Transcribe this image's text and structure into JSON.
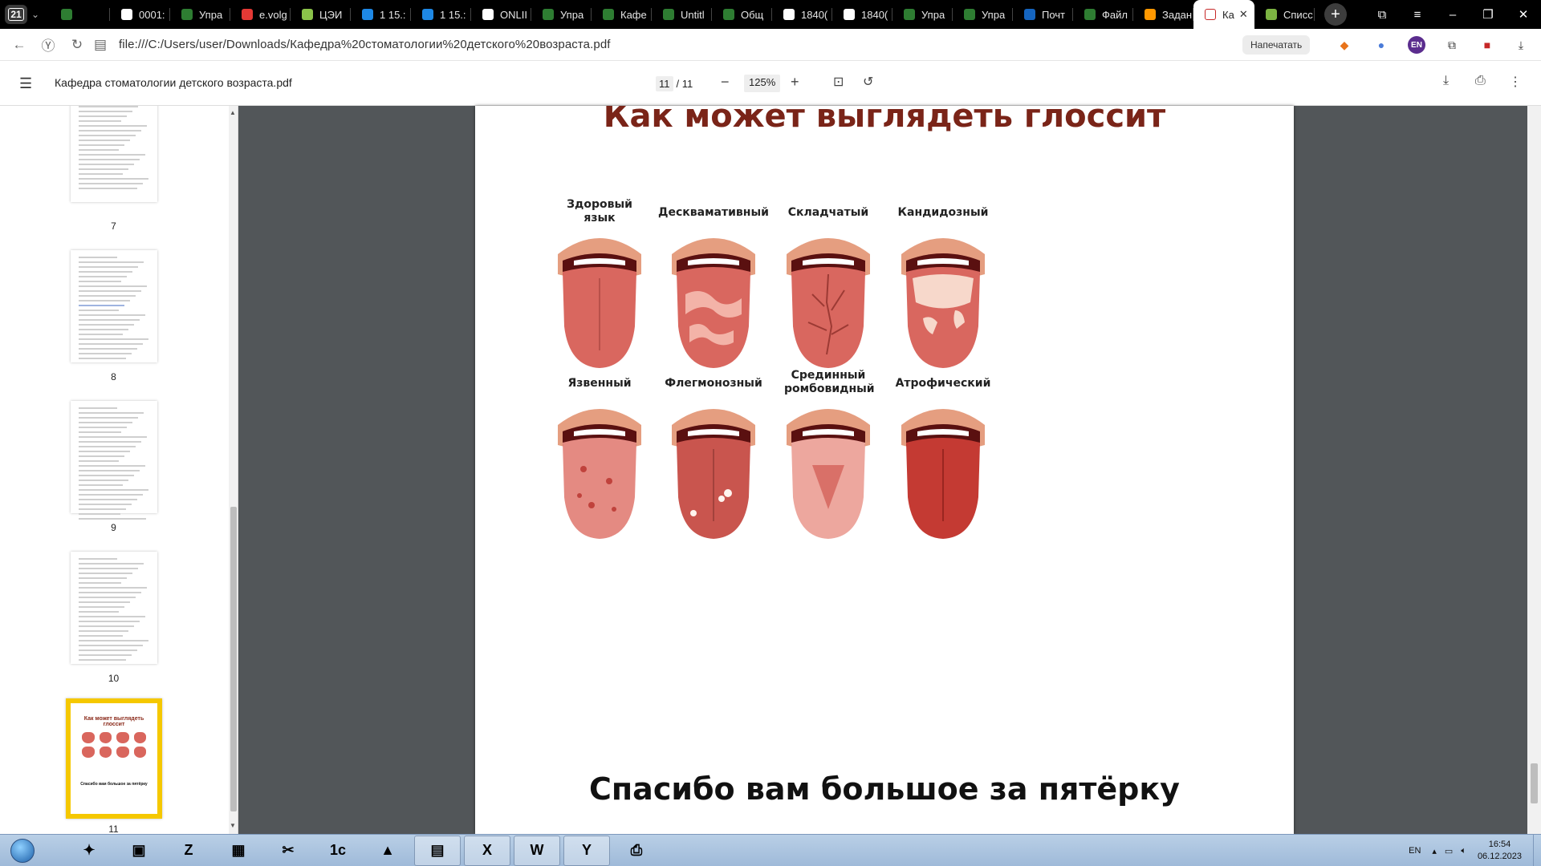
{
  "tab_strip": {
    "tab_count": "21",
    "tabs": [
      {
        "label": "",
        "icon": "green-circle-icon",
        "color": "#2e7d32"
      },
      {
        "label": "0001:",
        "icon": "pdf-icon",
        "color": "#ffffff"
      },
      {
        "label": "Упра",
        "icon": "green-circle-icon",
        "color": "#2e7d32"
      },
      {
        "label": "e.volg",
        "icon": "yandex-icon",
        "color": "#e53935"
      },
      {
        "label": "ЦЭИ",
        "icon": "grid-icon",
        "color": "#8bc34a"
      },
      {
        "label": "1 15.:",
        "icon": "docs-icon",
        "color": "#1e88e5"
      },
      {
        "label": "1 15.:",
        "icon": "docs-icon",
        "color": "#1e88e5"
      },
      {
        "label": "ONLII",
        "icon": "pdf-icon",
        "color": "#ffffff"
      },
      {
        "label": "Упра",
        "icon": "green-circle-icon",
        "color": "#2e7d32"
      },
      {
        "label": "Кафе",
        "icon": "green-circle-icon",
        "color": "#2e7d32"
      },
      {
        "label": "Untitl",
        "icon": "green-circle-icon",
        "color": "#2e7d32"
      },
      {
        "label": "Общ",
        "icon": "green-circle-icon",
        "color": "#2e7d32"
      },
      {
        "label": "1840(",
        "icon": "pdf-icon",
        "color": "#ffffff"
      },
      {
        "label": "1840(",
        "icon": "pdf-icon",
        "color": "#ffffff"
      },
      {
        "label": "Упра",
        "icon": "green-circle-icon",
        "color": "#2e7d32"
      },
      {
        "label": "Упра",
        "icon": "green-circle-icon",
        "color": "#2e7d32"
      },
      {
        "label": "Почт",
        "icon": "outlook-icon",
        "color": "#1565c0"
      },
      {
        "label": "Файл",
        "icon": "green-circle-icon",
        "color": "#2e7d32"
      },
      {
        "label": "Задан",
        "icon": "orange-logo-icon",
        "color": "#ff9800"
      }
    ],
    "active_tab": {
      "label": "Ка",
      "icon": "pdf-icon"
    },
    "after_tab": {
      "label": "Списс",
      "icon": "photo-icon"
    }
  },
  "address_bar": {
    "url": "file:///C:/Users/user/Downloads/Кафедра%20стоматологии%20детского%20возраста.pdf",
    "print_chip": "Напечатать",
    "profile_badge": "EN"
  },
  "pdf_toolbar": {
    "title": "Кафедра стоматологии детского возраста.pdf",
    "current_page": "11",
    "total_pages": "/ 11",
    "zoom": "125%"
  },
  "sidebar": {
    "thumbs": [
      {
        "label": "7"
      },
      {
        "label": "8"
      },
      {
        "label": "9"
      },
      {
        "label": "10"
      },
      {
        "label": "11"
      }
    ],
    "selected_mini_title": "Как может выглядеть глоссит",
    "selected_mini_footer": "Спасибо вам большое за пятёрку"
  },
  "slide": {
    "title": "Как может выглядеть глоссит",
    "row1": [
      {
        "label": "Здоровый язык",
        "fill": "#d9675f",
        "type": "healthy"
      },
      {
        "label": "Десквамативный",
        "fill": "#d9675f",
        "type": "desquamative"
      },
      {
        "label": "Складчатый",
        "fill": "#d9675f",
        "type": "folded"
      },
      {
        "label": "Кандидозный",
        "fill": "#d9675f",
        "type": "candida"
      }
    ],
    "row2": [
      {
        "label": "Язвенный",
        "fill": "#e48a82",
        "type": "ulcer"
      },
      {
        "label": "Флегмонозный",
        "fill": "#c9554e",
        "type": "phlegmon"
      },
      {
        "label": "Срединный ромбовидный",
        "fill": "#eda79e",
        "type": "rhomboid"
      },
      {
        "label": "Атрофический",
        "fill": "#c43a33",
        "type": "atrophic"
      }
    ],
    "footer": "Спасибо вам большое за пятёрку"
  },
  "taskbar": {
    "lang": "EN",
    "time": "16:54",
    "date": "06.12.2023",
    "apps": [
      {
        "name": "pinball-icon",
        "glyph": "✦",
        "open": false
      },
      {
        "name": "reader-icon",
        "glyph": "▣",
        "open": false
      },
      {
        "name": "zoom-icon",
        "glyph": "Z",
        "open": false
      },
      {
        "name": "calculator-icon",
        "glyph": "▦",
        "open": false
      },
      {
        "name": "scissors-icon",
        "glyph": "✂",
        "open": false
      },
      {
        "name": "1c-icon",
        "glyph": "1c",
        "open": false
      },
      {
        "name": "chart-app-icon",
        "glyph": "▲",
        "open": false
      },
      {
        "name": "explorer-icon",
        "glyph": "▤",
        "open": true
      },
      {
        "name": "excel-icon",
        "glyph": "X",
        "open": true
      },
      {
        "name": "word-icon",
        "glyph": "W",
        "open": true
      },
      {
        "name": "yandex-browser-icon",
        "glyph": "Y",
        "open": true
      },
      {
        "name": "scanner-icon",
        "glyph": "⎙",
        "open": false
      }
    ]
  }
}
